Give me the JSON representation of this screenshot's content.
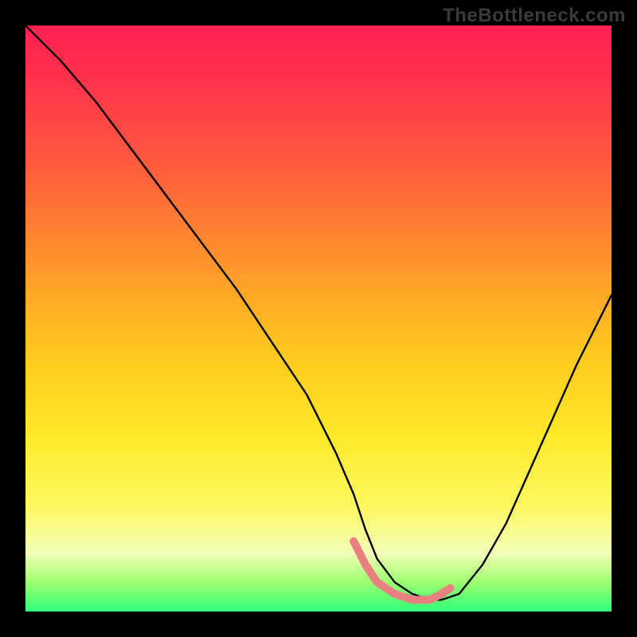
{
  "watermark": "TheBottleneck.com",
  "chart_data": {
    "type": "line",
    "title": "",
    "xlabel": "",
    "ylabel": "",
    "xlim": [
      0,
      100
    ],
    "ylim": [
      0,
      100
    ],
    "gradient_stops": [
      {
        "pos": 0,
        "color": "#ff1f53"
      },
      {
        "pos": 8,
        "color": "#ff2f4d"
      },
      {
        "pos": 22,
        "color": "#ff5640"
      },
      {
        "pos": 38,
        "color": "#ff8c2e"
      },
      {
        "pos": 55,
        "color": "#ffc61e"
      },
      {
        "pos": 70,
        "color": "#ffe92a"
      },
      {
        "pos": 82,
        "color": "#fdf960"
      },
      {
        "pos": 90,
        "color": "#f4ffb8"
      },
      {
        "pos": 95,
        "color": "#9cff70"
      },
      {
        "pos": 100,
        "color": "#2fff7a"
      }
    ],
    "series": [
      {
        "name": "black-curve",
        "stroke": "#000000",
        "x": [
          0,
          6,
          12,
          18,
          24,
          30,
          36,
          42,
          48,
          53,
          56,
          58,
          60,
          63,
          66,
          69,
          71,
          74,
          78,
          82,
          86,
          90,
          94,
          98,
          100
        ],
        "y": [
          100,
          94,
          87,
          79,
          71,
          63,
          55,
          46,
          37,
          27,
          20,
          14,
          9,
          5,
          3,
          2,
          2,
          3,
          8,
          15,
          24,
          33,
          42,
          50,
          54
        ]
      },
      {
        "name": "pink-highlight",
        "stroke": "#e98080",
        "x": [
          56,
          58,
          60,
          63,
          66,
          69,
          71,
          72.5
        ],
        "y": [
          12,
          8,
          5,
          3,
          2,
          2,
          3,
          4
        ]
      }
    ],
    "annotations": []
  }
}
